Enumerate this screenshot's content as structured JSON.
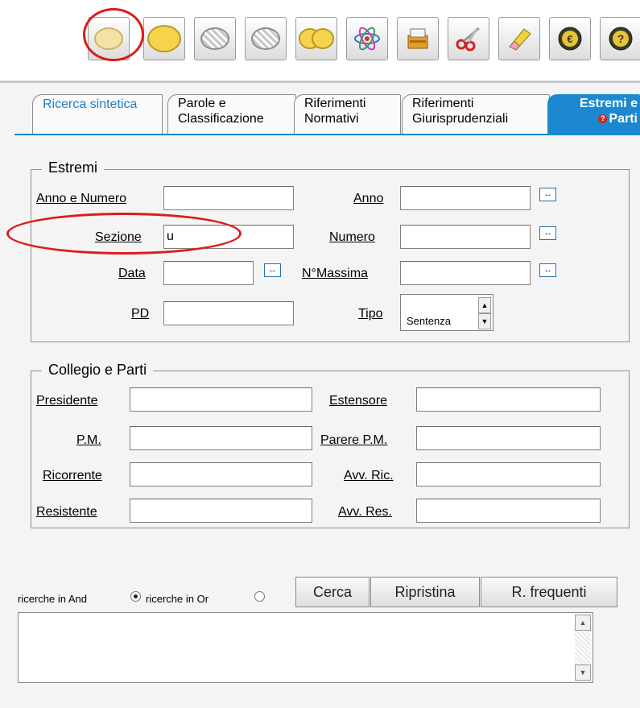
{
  "toolbar": {
    "icons": [
      "lens-pale-icon",
      "lens-yellow-icon",
      "lens-striped-icon",
      "lens-striped-grey-icon",
      "lens-merge-icon",
      "atom-icon",
      "archive-icon",
      "scissors-icon",
      "eraser-icon",
      "euro-icon",
      "help-icon"
    ]
  },
  "tabs": [
    {
      "line1": "Ricerca sintetica",
      "line2": ""
    },
    {
      "line1": "Parole e",
      "line2": "Classificazione"
    },
    {
      "line1": "Riferimenti",
      "line2": "Normativi"
    },
    {
      "line1": "Riferimenti",
      "line2": "Giurisprudenziali"
    },
    {
      "line1": "Estremi e",
      "line2": "Parti"
    }
  ],
  "estremi": {
    "legend": "Estremi",
    "anno_numero_label": "Anno e Numero",
    "anno_numero_value": "",
    "anno_label": "Anno",
    "anno_value": "",
    "sezione_label": "Sezione",
    "sezione_value": "u",
    "numero_label": "Numero",
    "numero_value": "",
    "data_label": "Data",
    "data_value": "",
    "nmassima_label": "N°Massima",
    "nmassima_value": "",
    "pd_label": "PD",
    "pd_value": "",
    "tipo_label": "Tipo",
    "tipo_value": "Sentenza",
    "range_glyph": "↔"
  },
  "collegio": {
    "legend": "Collegio e Parti",
    "presidente_label": "Presidente",
    "estensore_label": "Estensore",
    "pm_label": "P.M.",
    "parere_pm_label": "Parere P.M.",
    "ricorrente_label": "Ricorrente",
    "avv_ric_label": "Avv. Ric.",
    "resistente_label": "Resistente",
    "avv_res_label": "Avv. Res."
  },
  "search_mode": {
    "and_label": "ricerche in And",
    "or_label": "ricerche in Or",
    "selected": "and"
  },
  "buttons": {
    "cerca": "Cerca",
    "ripristina": "Ripristina",
    "frequenti": "R. frequenti"
  },
  "colors": {
    "active_tab": "#1b88cf",
    "annotation": "#dd1b1b"
  }
}
